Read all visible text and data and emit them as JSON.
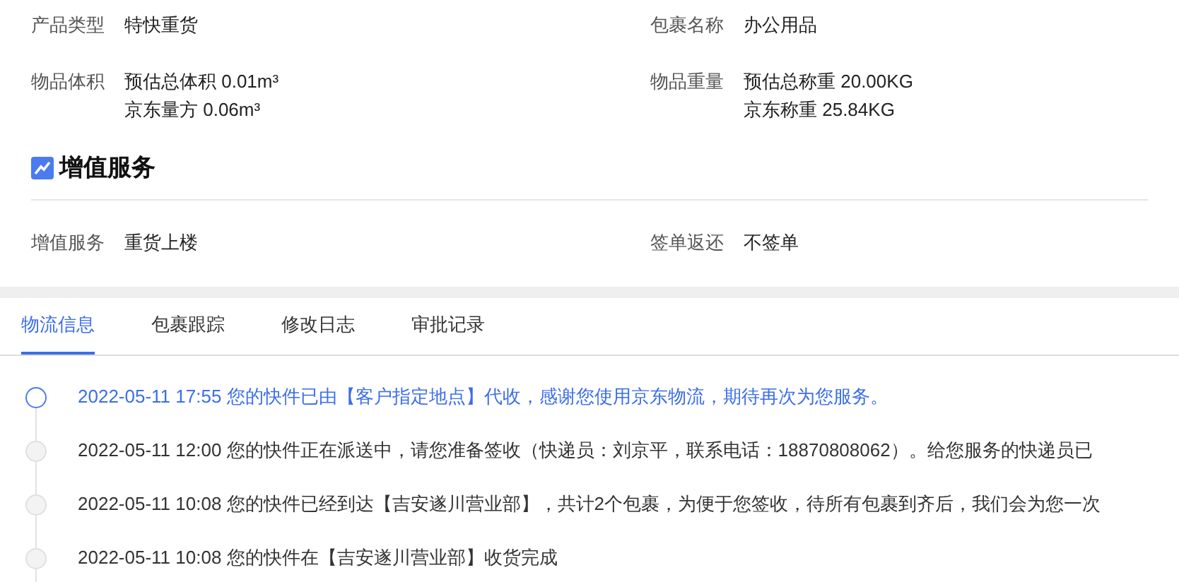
{
  "details": [
    {
      "label": "产品类型",
      "values": [
        "特快重货"
      ]
    },
    {
      "label": "包裹名称",
      "values": [
        "办公用品"
      ]
    },
    {
      "label": "物品体积",
      "values": [
        "预估总体积 0.01m³",
        "京东量方 0.06m³"
      ]
    },
    {
      "label": "物品重量",
      "values": [
        "预估总称重 20.00KG",
        "京东称重 25.84KG"
      ]
    }
  ],
  "section": {
    "title": "增值服务"
  },
  "services": [
    {
      "label": "增值服务",
      "values": [
        "重货上楼"
      ]
    },
    {
      "label": "签单返还",
      "values": [
        "不签单"
      ]
    }
  ],
  "tabs": [
    {
      "label": "物流信息",
      "selected": true
    },
    {
      "label": "包裹跟踪",
      "selected": false
    },
    {
      "label": "修改日志",
      "selected": false
    },
    {
      "label": "审批记录",
      "selected": false
    }
  ],
  "timeline": [
    {
      "text": "2022-05-11 17:55 您的快件已由【客户指定地点】代收，感谢您使用京东物流，期待再次为您服务。",
      "current": true
    },
    {
      "text": "2022-05-11 12:00 您的快件正在派送中，请您准备签收（快递员：刘京平，联系电话：18870808062）。给您服务的快递员已",
      "current": false
    },
    {
      "text": "2022-05-11 10:08 您的快件已经到达【吉安遂川营业部】，共计2个包裹，为便于您签收，待所有包裹到齐后，我们会为您一次",
      "current": false
    },
    {
      "text": "2022-05-11 10:08 您的快件在【吉安遂川营业部】收货完成",
      "current": false
    }
  ]
}
